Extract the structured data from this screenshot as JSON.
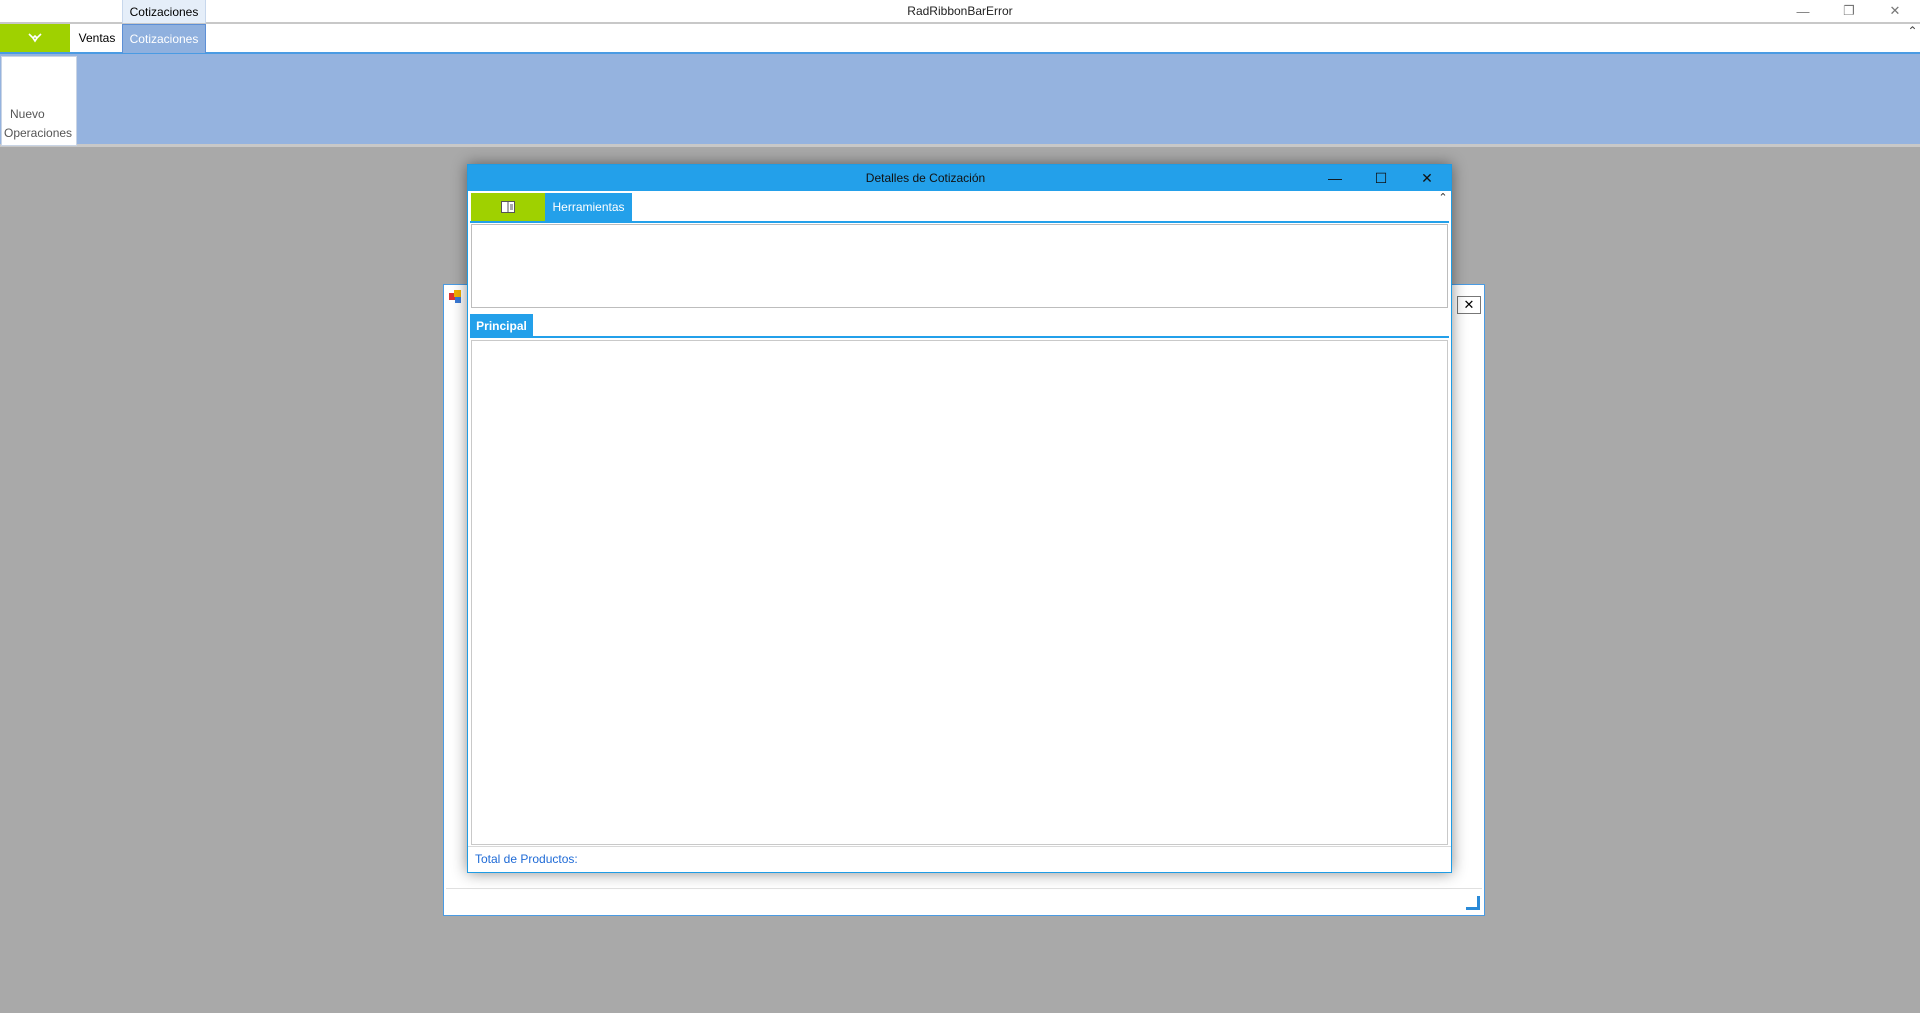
{
  "app": {
    "title": "RadRibbonBarError",
    "context_tab_header": "Cotizaciones",
    "window_controls": {
      "minimize": "—",
      "restore": "❐",
      "close": "✕"
    }
  },
  "ribbon": {
    "app_button_icon": "handshake-icon",
    "tabs": [
      {
        "label": "Ventas"
      },
      {
        "label": "Cotizaciones"
      }
    ],
    "collapse_glyph": "⌃",
    "buttons": [
      {
        "line1": "Nuevo",
        "line2": "Operaciones"
      }
    ]
  },
  "mdi_child": {
    "icon": "form-icon",
    "close_glyph": "✕"
  },
  "dialog": {
    "title": "Detalles de Cotización",
    "controls": {
      "minimize": "—",
      "maximize": "☐",
      "close": "✕"
    },
    "app_button_icon": "document-icon",
    "ribbon_tabs": [
      {
        "label": "Herramientas"
      }
    ],
    "collapse_glyph": "⌃",
    "page_tab": "Principal",
    "status_text": "Total de Productos:"
  },
  "colors": {
    "accent_blue": "#23a0ea",
    "ribbon_body": "#95b3df",
    "app_button_green": "#9fd100",
    "workspace_gray": "#a9a9a9"
  }
}
